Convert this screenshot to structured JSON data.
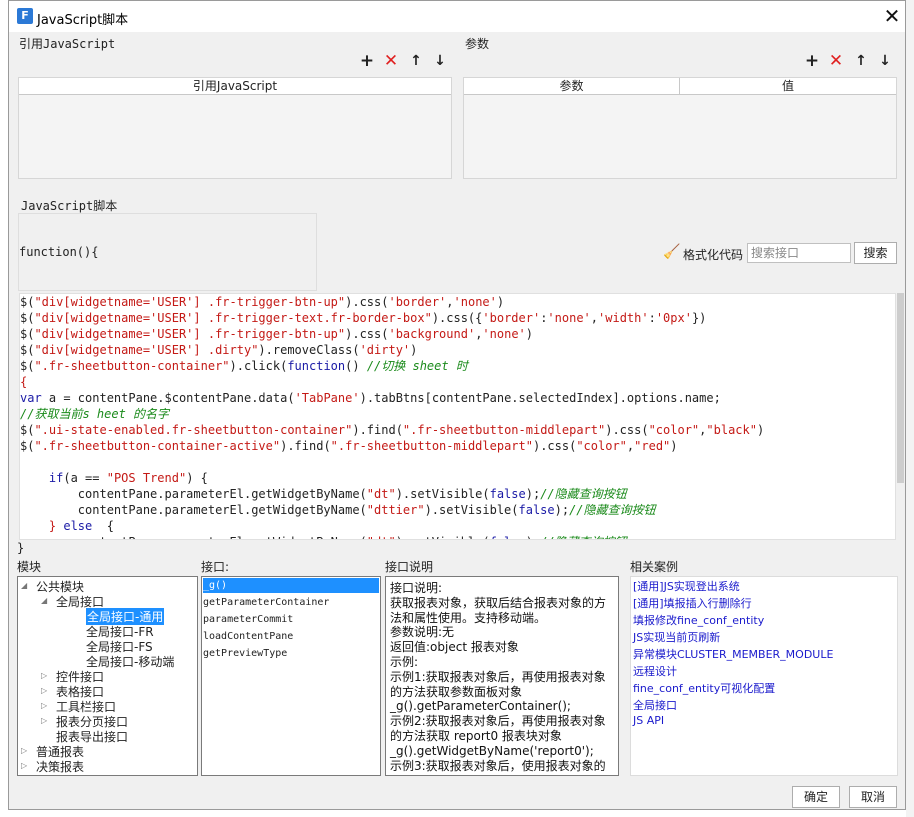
{
  "window": {
    "title": "JavaScript脚本",
    "icon": "app-logo-icon"
  },
  "ref_js": {
    "section": "引用JavaScript",
    "column": "引用JavaScript"
  },
  "params": {
    "section": "参数",
    "columns": [
      "参数",
      "值"
    ]
  },
  "toolbar": {
    "add": "+",
    "remove": "✕",
    "up": "↑",
    "down": "↓"
  },
  "script": {
    "section": "JavaScript脚本",
    "func_open": "function(){",
    "func_close": "}",
    "format_label": "格式化代码",
    "search_placeholder": "搜索接口",
    "search_button": "搜索"
  },
  "modules": {
    "header": "模块",
    "tree": [
      {
        "label": "公共模块",
        "level": 0,
        "expanded": true
      },
      {
        "label": "全局接口",
        "level": 1,
        "expanded": true
      },
      {
        "label": "全局接口-通用",
        "level": 2,
        "selected": true
      },
      {
        "label": "全局接口-FR",
        "level": 2
      },
      {
        "label": "全局接口-FS",
        "level": 2
      },
      {
        "label": "全局接口-移动端",
        "level": 2
      },
      {
        "label": "控件接口",
        "level": 1,
        "expanded": false
      },
      {
        "label": "表格接口",
        "level": 1,
        "expanded": false
      },
      {
        "label": "工具栏接口",
        "level": 1,
        "expanded": false
      },
      {
        "label": "报表分页接口",
        "level": 1,
        "expanded": false
      },
      {
        "label": "报表导出接口",
        "level": 1
      },
      {
        "label": "普通报表",
        "level": 0,
        "expanded": false
      },
      {
        "label": "决策报表",
        "level": 0,
        "expanded": false
      }
    ]
  },
  "interfaces": {
    "header": "接口:",
    "items": [
      "_g()",
      "getParameterContainer",
      "parameterCommit",
      "loadContentPane",
      "getPreviewType"
    ]
  },
  "description": {
    "header": "接口说明",
    "text": "接口说明:\n获取报表对象，获取后结合报表对象的方法和属性使用。支持移动端。\n参数说明:无\n返回值:object 报表对象\n示例:\n示例1:获取报表对象后，再使用报表对象的方法获取参数面板对象\n_g().getParameterContainer();\n示例2:获取报表对象后，再使用报表对象的方法获取 report0 报表块对象\n_g().getWidgetByName('report0');\n示例3:获取报表对象后，使用报表对象的"
  },
  "cases": {
    "header": "相关案例",
    "items": [
      "[通用]JS实现登出系统",
      "[通用]填报插入行删除行",
      "填报修改fine_conf_entity",
      "JS实现当前页刷新",
      "异常模块CLUSTER_MEMBER_MODULE",
      "远程设计",
      "fine_conf_entity可视化配置",
      "全局接口",
      "JS API"
    ]
  },
  "footer": {
    "ok": "确定",
    "cancel": "取消"
  },
  "code_lines": [
    [
      [
        "$(",
        ""
      ],
      [
        "\"div[widgetname='USER'] .fr-trigger-btn-up\"",
        "s"
      ],
      [
        ").css(",
        ""
      ],
      [
        "'border'",
        "s"
      ],
      [
        ",",
        ""
      ],
      [
        "'none'",
        "s"
      ],
      [
        ")",
        ""
      ]
    ],
    [
      [
        "$(",
        ""
      ],
      [
        "\"div[widgetname='USER'] .fr-trigger-text.fr-border-box\"",
        "s"
      ],
      [
        ").css({",
        ""
      ],
      [
        "'border'",
        "s"
      ],
      [
        ":",
        ""
      ],
      [
        "'none'",
        "s"
      ],
      [
        ",",
        ""
      ],
      [
        "'width'",
        "s"
      ],
      [
        ":",
        ""
      ],
      [
        "'0px'",
        "s"
      ],
      [
        "})",
        ""
      ]
    ],
    [
      [
        "$(",
        ""
      ],
      [
        "\"div[widgetname='USER'] .fr-trigger-btn-up\"",
        "s"
      ],
      [
        ").css(",
        ""
      ],
      [
        "'background'",
        "s"
      ],
      [
        ",",
        ""
      ],
      [
        "'none'",
        "s"
      ],
      [
        ")",
        ""
      ]
    ],
    [
      [
        "$(",
        ""
      ],
      [
        "\"div[widgetname='USER'] .dirty\"",
        "s"
      ],
      [
        ").removeClass(",
        ""
      ],
      [
        "'dirty'",
        "s"
      ],
      [
        ")",
        ""
      ]
    ],
    [
      [
        "$(",
        ""
      ],
      [
        "\".fr-sheetbutton-container\"",
        "s"
      ],
      [
        ").click(",
        ""
      ],
      [
        "function",
        "k"
      ],
      [
        "() ",
        ""
      ],
      [
        "//切换 sheet 时",
        "c"
      ]
    ],
    [
      [
        "{",
        "s"
      ]
    ],
    [
      [
        "var",
        "k"
      ],
      [
        " a = contentPane.$contentPane.data(",
        ""
      ],
      [
        "'TabPane'",
        "s"
      ],
      [
        ").tabBtns[contentPane.selectedIndex].options.name;",
        ""
      ]
    ],
    [
      [
        "//获取当前s heet 的名字",
        "c"
      ]
    ],
    [
      [
        "$(",
        ""
      ],
      [
        "\".ui-state-enabled.fr-sheetbutton-container\"",
        "s"
      ],
      [
        ").find(",
        ""
      ],
      [
        "\".fr-sheetbutton-middlepart\"",
        "s"
      ],
      [
        ").css(",
        ""
      ],
      [
        "\"color\"",
        "s"
      ],
      [
        ",",
        ""
      ],
      [
        "\"black\"",
        "s"
      ],
      [
        ")",
        ""
      ]
    ],
    [
      [
        "$(",
        ""
      ],
      [
        "\".fr-sheetbutton-container-active\"",
        "s"
      ],
      [
        ").find(",
        ""
      ],
      [
        "\".fr-sheetbutton-middlepart\"",
        "s"
      ],
      [
        ").css(",
        ""
      ],
      [
        "\"color\"",
        "s"
      ],
      [
        ",",
        ""
      ],
      [
        "\"red\"",
        "s"
      ],
      [
        ")",
        ""
      ]
    ],
    [
      [
        "",
        ""
      ]
    ],
    [
      [
        "    ",
        ""
      ],
      [
        "if",
        "k"
      ],
      [
        "(a == ",
        ""
      ],
      [
        "\"POS Trend\"",
        "s"
      ],
      [
        ") {",
        ""
      ]
    ],
    [
      [
        "        contentPane.parameterEl.getWidgetByName(",
        ""
      ],
      [
        "\"dt\"",
        "s"
      ],
      [
        ").setVisible(",
        ""
      ],
      [
        "false",
        "k"
      ],
      [
        ");",
        ""
      ],
      [
        "//隐藏查询按钮",
        "c"
      ]
    ],
    [
      [
        "        contentPane.parameterEl.getWidgetByName(",
        ""
      ],
      [
        "\"dttier\"",
        "s"
      ],
      [
        ").setVisible(",
        ""
      ],
      [
        "false",
        "k"
      ],
      [
        ");",
        ""
      ],
      [
        "//隐藏查询按钮",
        "c"
      ]
    ],
    [
      [
        "    } ",
        "s"
      ],
      [
        "else",
        "k"
      ],
      [
        "  {",
        ""
      ]
    ],
    [
      [
        "        contentPane.parameterEl.getWidgetByName(",
        ""
      ],
      [
        "\"dt\"",
        "s"
      ],
      [
        ").setVisible(",
        ""
      ],
      [
        "false",
        "k"
      ],
      [
        ");",
        ""
      ],
      [
        "//隐藏查询按钮",
        "c"
      ]
    ]
  ]
}
